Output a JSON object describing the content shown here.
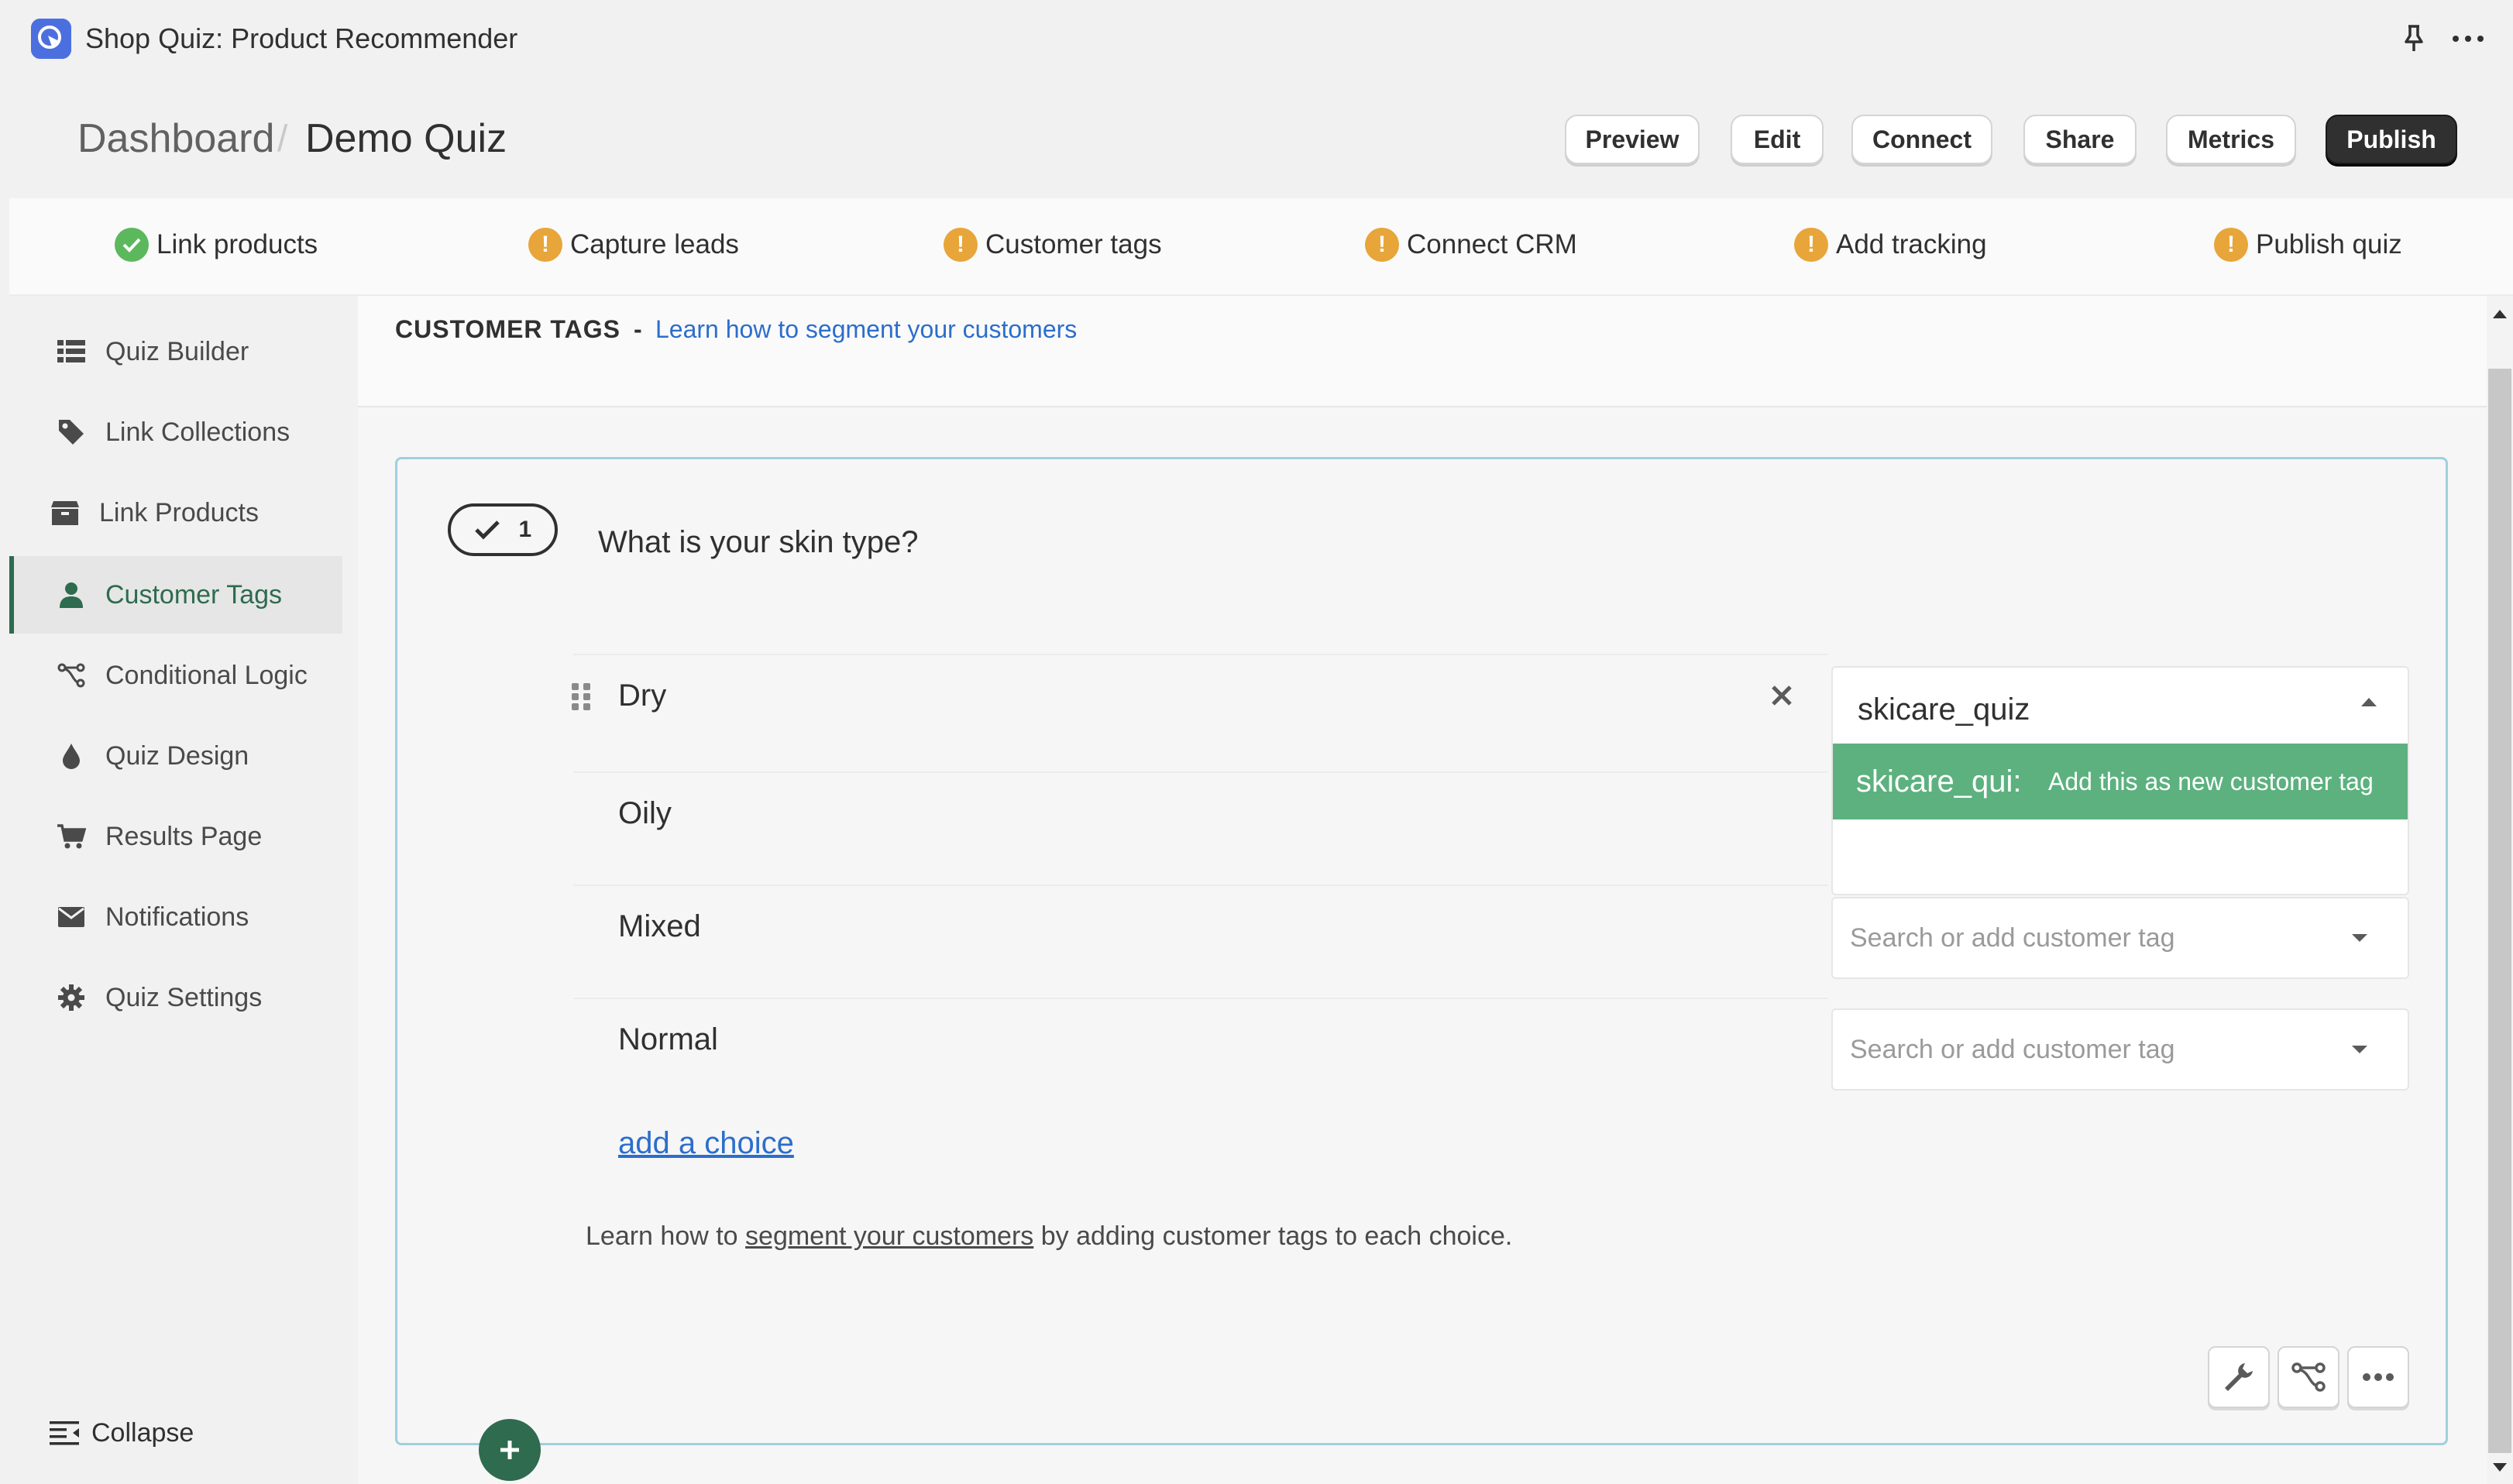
{
  "app": {
    "title": "Shop Quiz: Product Recommender"
  },
  "header": {
    "breadcrumb": [
      "Dashboard",
      "Demo Quiz"
    ],
    "buttons": [
      "Preview",
      "Edit",
      "Connect",
      "Share",
      "Metrics",
      "Publish"
    ]
  },
  "steps": [
    {
      "label": "Link products",
      "status": "done"
    },
    {
      "label": "Capture leads",
      "status": "warning"
    },
    {
      "label": "Customer tags",
      "status": "warning"
    },
    {
      "label": "Connect CRM",
      "status": "warning"
    },
    {
      "label": "Add tracking",
      "status": "warning"
    },
    {
      "label": "Publish quiz",
      "status": "warning"
    }
  ],
  "sidebar": {
    "items": [
      {
        "label": "Quiz Builder",
        "icon": "list-icon"
      },
      {
        "label": "Link Collections",
        "icon": "tag-icon"
      },
      {
        "label": "Link Products",
        "icon": "box-icon"
      },
      {
        "label": "Customer Tags",
        "icon": "user-icon",
        "active": true
      },
      {
        "label": "Conditional Logic",
        "icon": "branch-icon"
      },
      {
        "label": "Quiz Design",
        "icon": "droplet-icon"
      },
      {
        "label": "Results Page",
        "icon": "cart-icon"
      },
      {
        "label": "Notifications",
        "icon": "envelope-icon"
      },
      {
        "label": "Quiz Settings",
        "icon": "gear-icon"
      }
    ],
    "collapse_label": "Collapse"
  },
  "section": {
    "title": "CUSTOMER TAGS",
    "separator": "-",
    "link": "Learn how to segment your customers"
  },
  "question": {
    "number": "1",
    "text": "What is your skin type?",
    "choices": [
      "Dry",
      "Oily",
      "Mixed",
      "Normal"
    ],
    "add_choice": "add a choice"
  },
  "tag_dropdown": {
    "input_value": "skicare_quiz",
    "option_value": "skicare_qui:",
    "option_hint": "Add this as new customer tag",
    "placeholder": "Search or add customer tag"
  },
  "help": {
    "prefix": "Learn how to ",
    "link": "segment your customers",
    "suffix": " by adding customer tags to each choice."
  },
  "colors": {
    "accent_green": "#2e6b4f",
    "option_green": "#5cb17f",
    "link_blue": "#2c6ecb",
    "warning": "#e8a53a",
    "success": "#5cb85c"
  }
}
